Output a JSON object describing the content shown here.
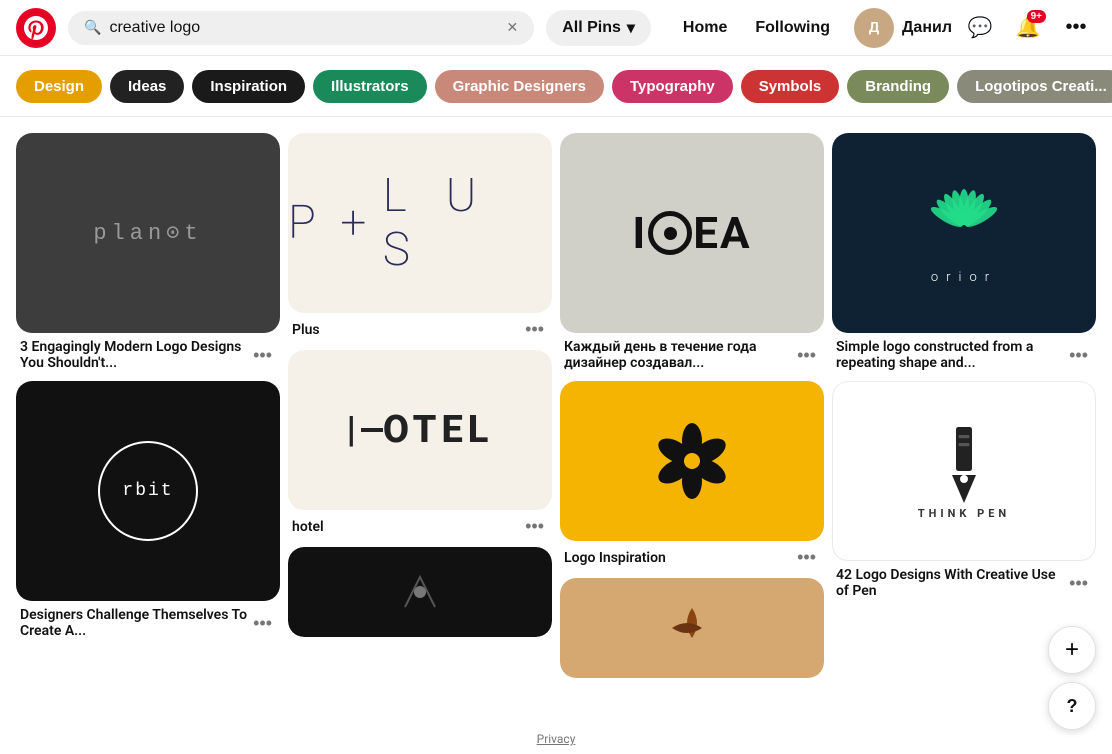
{
  "header": {
    "search_value": "creative logo",
    "search_placeholder": "Search",
    "filter_label": "All Pins",
    "nav": [
      "Home",
      "Following"
    ],
    "user_name": "Данил",
    "notification_badge": "9+",
    "more_label": "..."
  },
  "categories": {
    "chevron_icon": "›",
    "items": [
      {
        "label": "Design",
        "color": "#e59e00",
        "text_color": "#fff"
      },
      {
        "label": "Ideas",
        "color": "#222222",
        "text_color": "#fff"
      },
      {
        "label": "Inspiration",
        "color": "#1a1a1a",
        "text_color": "#fff"
      },
      {
        "label": "Illustrators",
        "color": "#1b8a5a",
        "text_color": "#fff"
      },
      {
        "label": "Graphic Designers",
        "color": "#c8897a",
        "text_color": "#fff"
      },
      {
        "label": "Typography",
        "color": "#cc3366",
        "text_color": "#fff"
      },
      {
        "label": "Symbols",
        "color": "#cc3333",
        "text_color": "#fff"
      },
      {
        "label": "Branding",
        "color": "#7a8a5a",
        "text_color": "#fff"
      },
      {
        "label": "Logotipos Creati...",
        "color": "#8a8a7a",
        "text_color": "#fff"
      }
    ]
  },
  "pins": {
    "col1": [
      {
        "id": "planet",
        "title": "3 Engagingly Modern Logo Designs You Shouldn't...",
        "has_title": true
      },
      {
        "id": "rbit",
        "title": "Designers Challenge Themselves To Create A...",
        "has_title": true
      }
    ],
    "col2": [
      {
        "id": "plus",
        "title": "Plus",
        "has_title": true
      },
      {
        "id": "hotel",
        "title": "hotel",
        "has_title": true
      },
      {
        "id": "dark_bottom",
        "title": "",
        "has_title": false
      }
    ],
    "col3": [
      {
        "id": "idea",
        "title": "Каждый день в течение года дизайнер создавал...",
        "has_title": true
      },
      {
        "id": "bee",
        "title": "Logo Inspiration",
        "has_title": true
      },
      {
        "id": "abstract",
        "title": "",
        "has_title": false
      }
    ],
    "col4": [
      {
        "id": "orior",
        "title": "Simple logo constructed from a repeating shape and...",
        "has_title": true
      },
      {
        "id": "pen",
        "title": "42 Logo Designs With Creative Use of Pen",
        "has_title": true
      }
    ]
  },
  "floating": {
    "add_icon": "+",
    "help_icon": "?",
    "privacy_label": "Privacy"
  }
}
